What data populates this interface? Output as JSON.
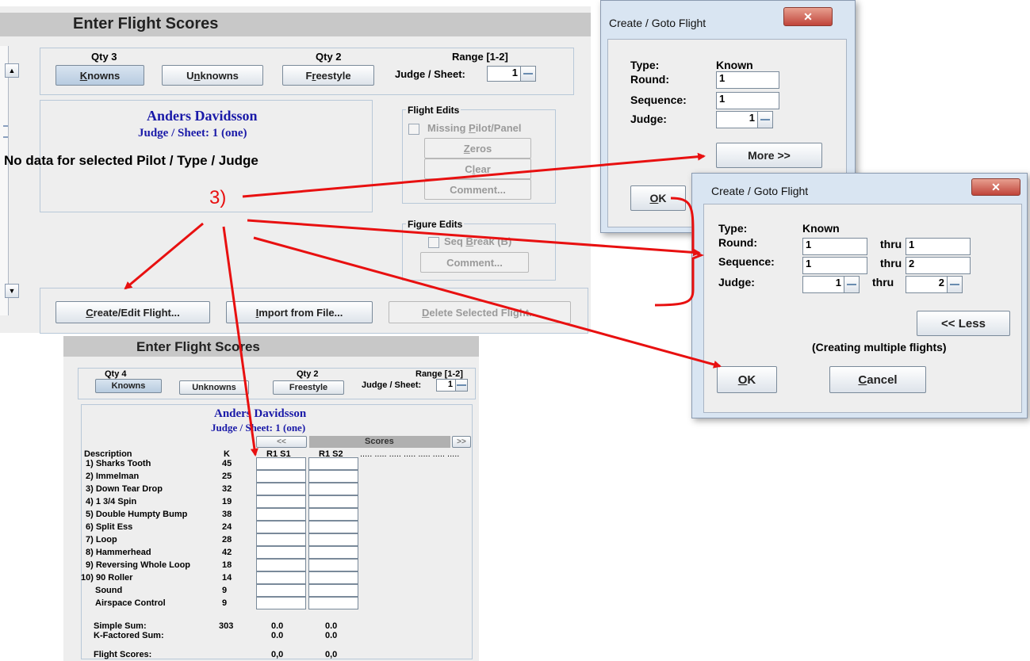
{
  "main": {
    "title": "Enter Flight Scores",
    "qty_knowns": "Qty 3",
    "qty_freestyle": "Qty 2",
    "range": "Range [1-2]",
    "knowns_label": "K",
    "knowns_rest": "nowns",
    "unknowns_pre": "U",
    "unknowns_u": "n",
    "unknowns_rest": "knowns",
    "freestyle_pre": "F",
    "freestyle_u": "r",
    "freestyle_rest": "eestyle",
    "judge_sheet_label": "Judge / Sheet:",
    "judge_sheet_value": "1",
    "pilot_name": "Anders Davidsson",
    "judge_sheet_text": "Judge / Sheet:  1 (one)",
    "no_data": "No data for selected Pilot / Type / Judge",
    "flight_edits": "Flight Edits",
    "missing_pre": "Missing ",
    "missing_u": "P",
    "missing_rest": "ilot/Panel",
    "zeros_u": "Z",
    "zeros_rest": "eros",
    "clear_pre": "C",
    "clear_u": "l",
    "clear_rest": "ear",
    "comment": "Comment...",
    "figure_edits": "Figure Edits",
    "seq_pre": "Seq ",
    "seq_u": "B",
    "seq_rest": "reak (B)",
    "figure_comment": "Comment...",
    "create_u": "C",
    "create_rest": "reate/Edit Flight...",
    "import_u": "I",
    "import_rest": "mport from File...",
    "delete_u": "D",
    "delete_rest": "elete Selected Flight..."
  },
  "annotation": {
    "label": "3)"
  },
  "dialog_small": {
    "title": "Create / Goto Flight",
    "type_label": "Type:",
    "type_value": "Known",
    "round_label": "Round:",
    "round_value": "1",
    "sequence_label": "Sequence:",
    "sequence_value": "1",
    "judge_label": "Judge:",
    "judge_value": "1",
    "more": "More >>",
    "ok_u": "O",
    "ok_rest": "K"
  },
  "dialog_large": {
    "title": "Create / Goto Flight",
    "type_label": "Type:",
    "type_value": "Known",
    "round_label": "Round:",
    "round_from": "1",
    "round_to": "1",
    "sequence_label": "Sequence:",
    "sequence_from": "1",
    "sequence_to": "2",
    "judge_label": "Judge:",
    "judge_from": "1",
    "judge_to": "2",
    "thru": "thru",
    "less": "<< Less",
    "note": "(Creating multiple flights)",
    "ok_u": "O",
    "ok_rest": "K",
    "cancel_u": "C",
    "cancel_rest": "ancel"
  },
  "lower": {
    "title": "Enter Flight Scores",
    "qty_knowns": "Qty 4",
    "qty_freestyle": "Qty 2",
    "range": "Range [1-2]",
    "knowns": "Knowns",
    "unknowns": "Unknowns",
    "freestyle": "Freestyle",
    "judge_sheet_label": "Judge / Sheet:",
    "judge_sheet_value": "1",
    "pilot_name": "Anders Davidsson",
    "judge_sheet_text": "Judge / Sheet:  1 (one)",
    "prev": "<<",
    "scores": "Scores",
    "next": ">>",
    "col_description": "Description",
    "col_k": "K",
    "col_s1": "R1 S1",
    "col_s2": "R1 S2",
    "dots": "..... ..... ..... ..... ..... ..... .....",
    "rows": [
      {
        "desc": "1) Sharks Tooth",
        "k": "45"
      },
      {
        "desc": "2) Immelman",
        "k": "25"
      },
      {
        "desc": "3) Down Tear Drop",
        "k": "32"
      },
      {
        "desc": "4) 1 3/4 Spin",
        "k": "19"
      },
      {
        "desc": "5) Double Humpty Bump",
        "k": "38"
      },
      {
        "desc": "6) Split Ess",
        "k": "24"
      },
      {
        "desc": "7) Loop",
        "k": "28"
      },
      {
        "desc": "8) Hammerhead",
        "k": "42"
      },
      {
        "desc": "9) Reversing Whole Loop",
        "k": "18"
      },
      {
        "desc": "10) 90 Roller",
        "k": "14"
      },
      {
        "desc": "Sound",
        "k": "9"
      },
      {
        "desc": "Airspace Control",
        "k": "9"
      }
    ],
    "simple_sum_label": "Simple Sum:",
    "simple_sum_k": "303",
    "simple_sum_s1": "0.0",
    "simple_sum_s2": "0.0",
    "kfactored_label": "K-Factored Sum:",
    "kfactored_s1": "0.0",
    "kfactored_s2": "0.0",
    "flight_scores_label": "Flight Scores:",
    "flight_scores_s1": "0,0",
    "flight_scores_s2": "0,0"
  }
}
